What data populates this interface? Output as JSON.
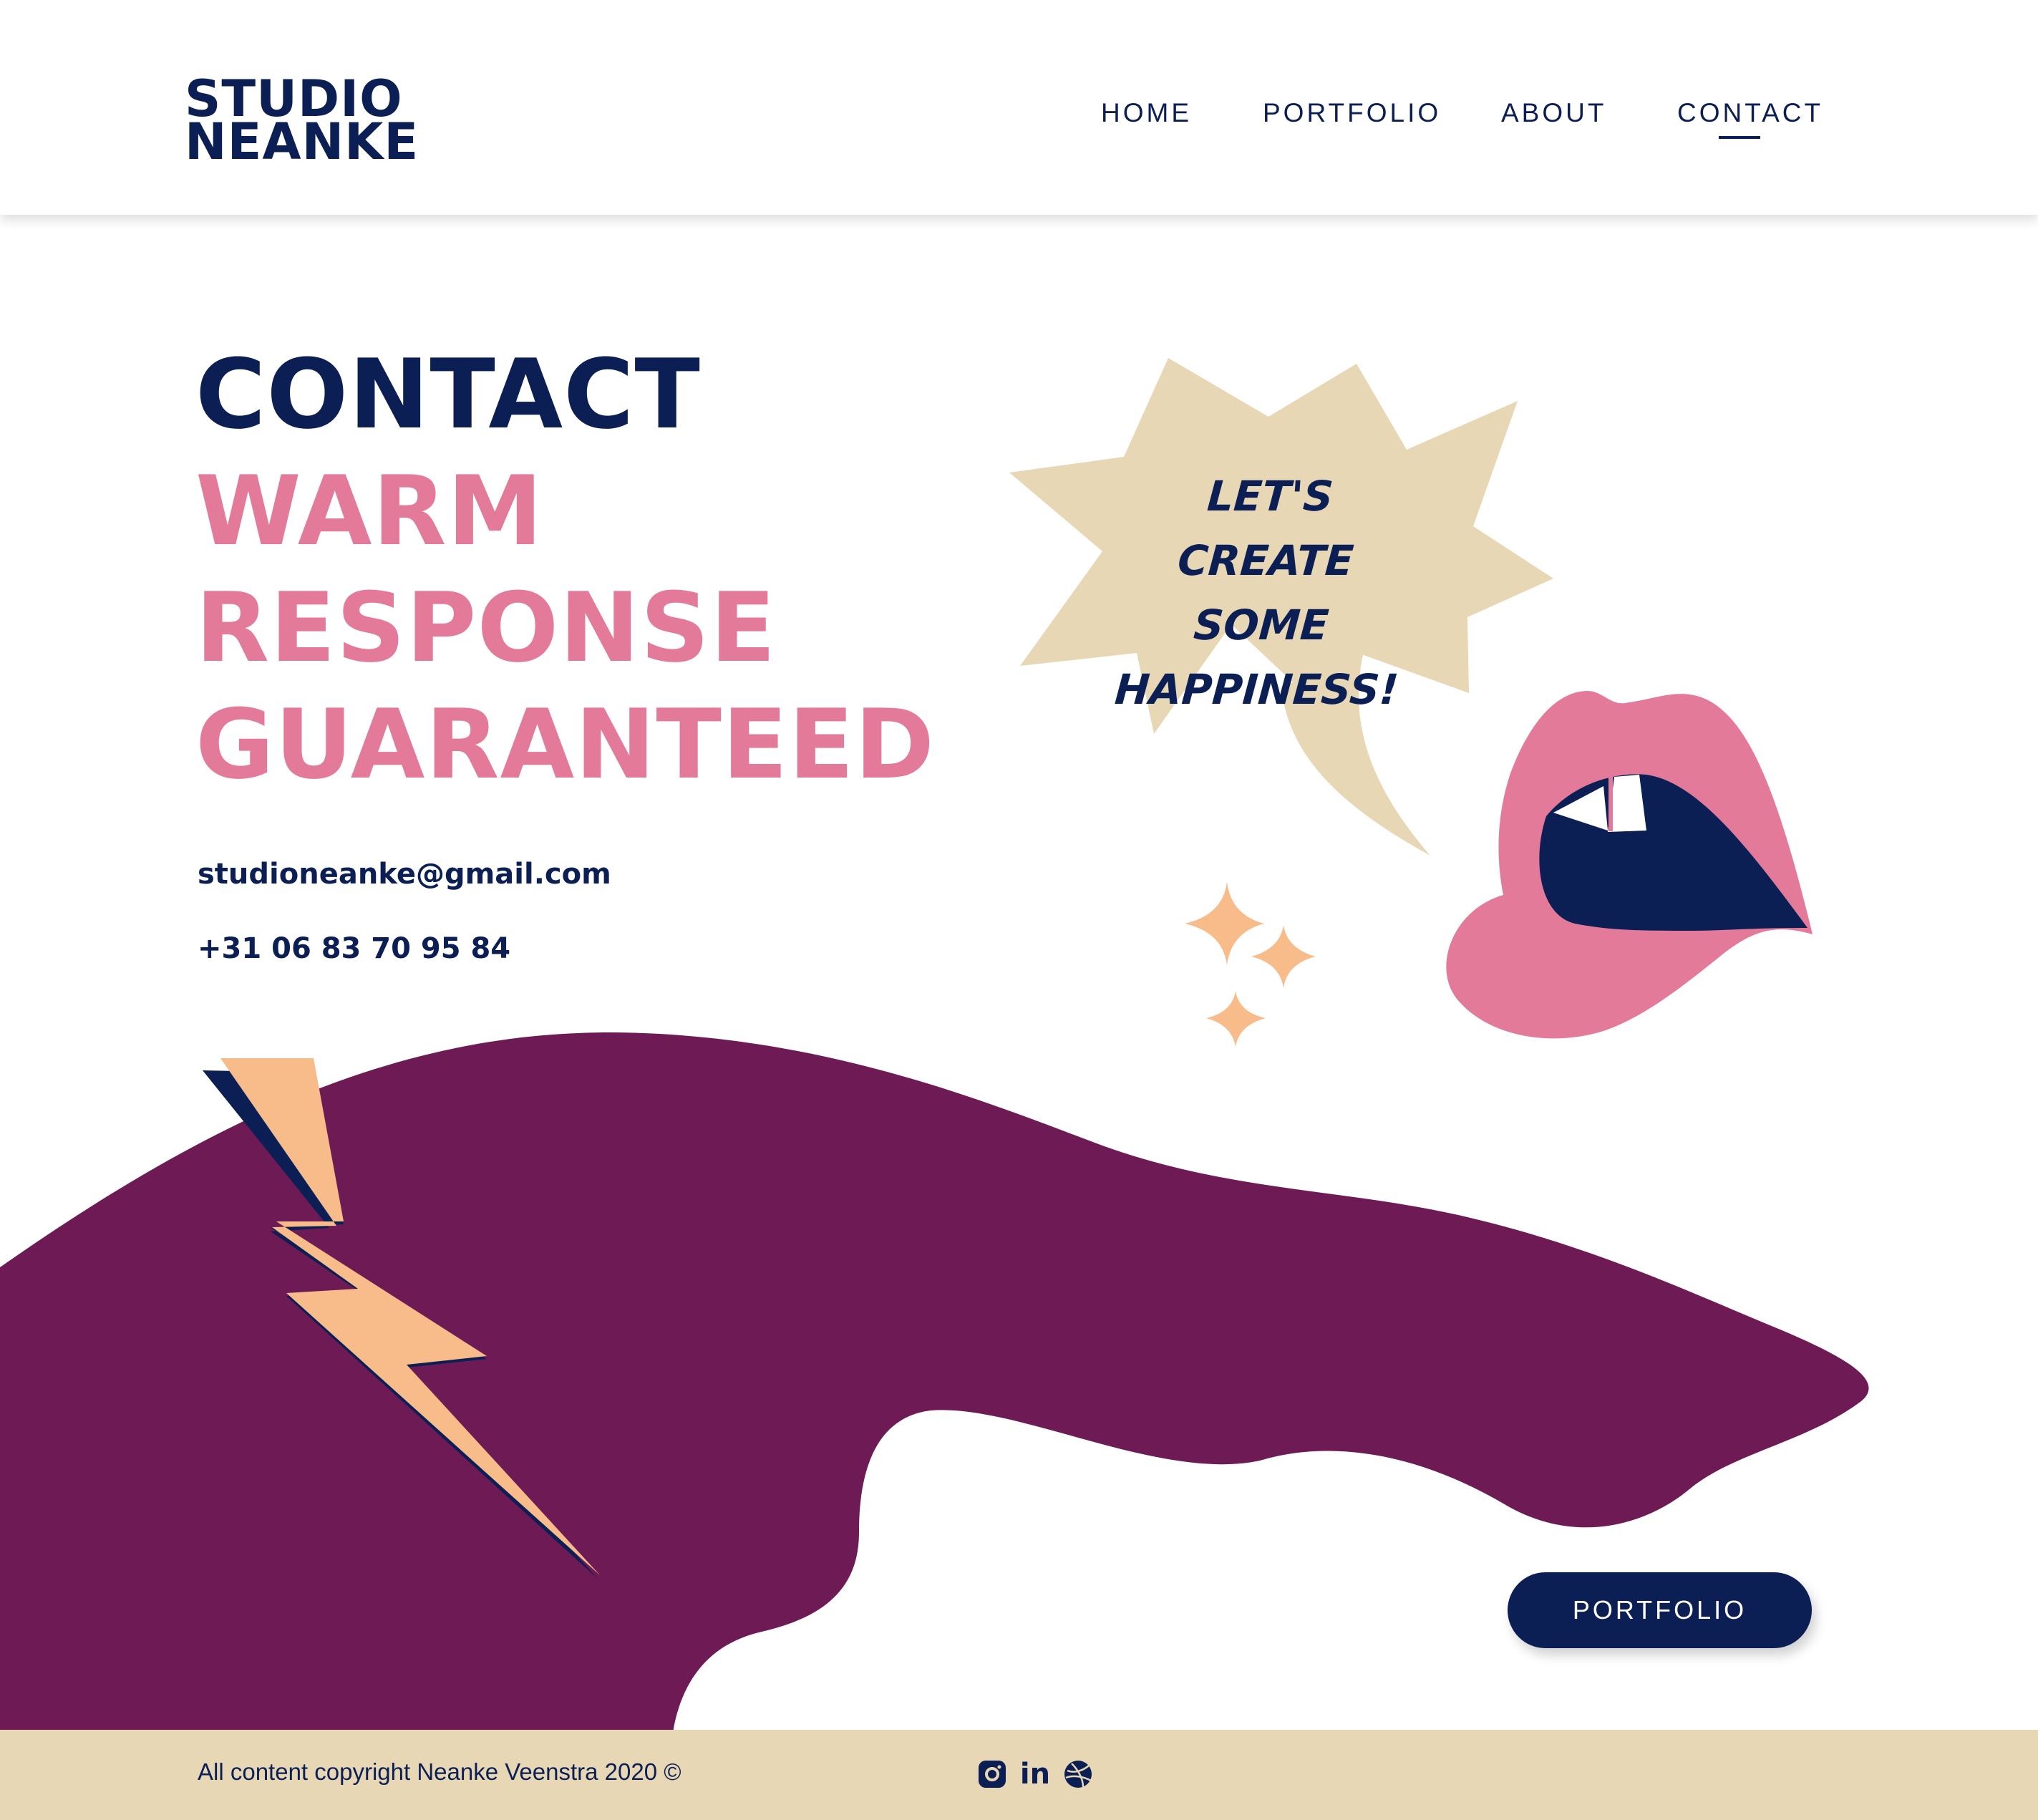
{
  "brand": {
    "logo_line1": "STUDIO",
    "logo_line2": "NEANKE"
  },
  "nav": {
    "items": [
      {
        "label": "HOME"
      },
      {
        "label": "PORTFOLIO"
      },
      {
        "label": "ABOUT"
      },
      {
        "label": "CONTACT",
        "active": true
      }
    ]
  },
  "hero": {
    "title": "CONTACT",
    "subtitle_lines": [
      "WARM",
      "RESPONSE",
      "GUARANTEED"
    ],
    "email": "studioneanke@gmail.com",
    "phone": "+31 06 83 70 95 84"
  },
  "bubble": {
    "lines": [
      "LET'S CREATE",
      "SOME",
      "HAPPINESS!"
    ]
  },
  "cta": {
    "portfolio_label": "PORTFOLIO"
  },
  "footer": {
    "copyright": "All content copyright Neanke Veenstra 2020 ©",
    "social_icons": [
      "instagram-icon",
      "linkedin-icon",
      "dribbble-icon"
    ],
    "linkedin_glyph": "in"
  },
  "colors": {
    "navy": "#0c1f55",
    "pink": "#e47a9a",
    "plum": "#6e1a55",
    "sand": "#e8d7b5",
    "peach": "#f8bc8b"
  }
}
